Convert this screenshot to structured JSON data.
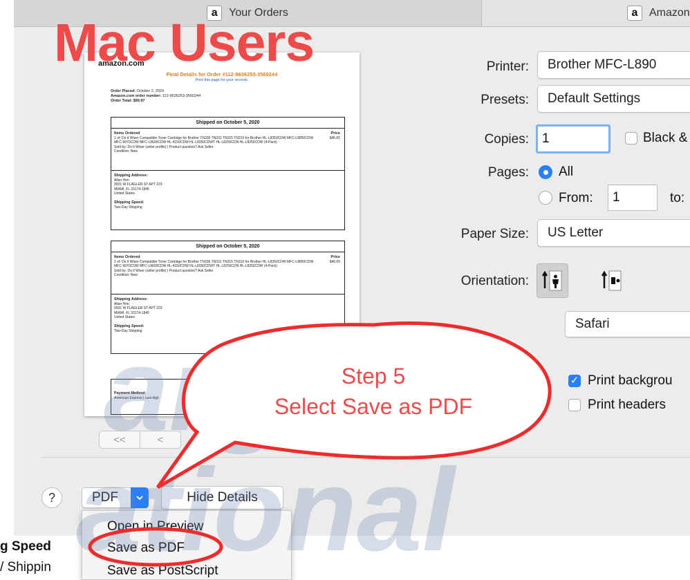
{
  "overlay": {
    "heading": "Mac Users",
    "callout_line1": "Step 5",
    "callout_line2": "Select Save as PDF",
    "accent_color": "#ef4a4a"
  },
  "tabs": [
    {
      "label": "Your Orders",
      "icon": "amazon-logo-icon"
    },
    {
      "label": "Amazon",
      "icon": "amazon-logo-icon"
    }
  ],
  "preview_doc": {
    "logo": "amazon.com",
    "title": "Final Details for Order #112-9636253-3560244",
    "print_link": "Print this page for your records.",
    "order_placed_label": "Order Placed:",
    "order_placed": "October 2, 2020",
    "order_number_label": "Amazon.com order number:",
    "order_number": "112-9636253-3560244",
    "order_total_label": "Order Total:",
    "order_total": "$90.97",
    "shipments": [
      {
        "heading": "Shipped on October 5, 2020",
        "items_label": "Items Ordered",
        "price_label": "Price",
        "item": "1 of: Do it Wiser Compatible Toner Cartridge for Brother TN336 TN331 TN315 TN310 for Brother HL-L8350CDW MFC-L8850CDW MFC-9970CDW MFC-L8600CDW HL-4150CDW HL-L8350CDWT HL-L8250CDN HL-L8250CDW (4-Pack)",
        "sold_by": "Sold by: Do it Wiser (seller profile) | Product question? Ask Seller",
        "condition": "Condition: New",
        "price": "$46.65",
        "ship_addr_label": "Shipping Address:",
        "ship_addr": [
          "Allan Hon",
          "9931 W FLAGLER ST APT 223",
          "MIAMI, FL 33174-1845",
          "United States"
        ],
        "speed_label": "Shipping Speed:",
        "speed": "Two-Day Shipping"
      },
      {
        "heading": "Shipped on October 5, 2020",
        "items_label": "Items Ordered",
        "price_label": "Price",
        "item": "1 of: Do it Wiser Compatible Toner Cartridge for Brother TN336 TN331 TN315 TN310 for Brother HL-L8350CDW MFC-L8850CDW MFC-9970CDW MFC-L8600CDW HL-4150CDW HL-L8350CDWT HL-L8250CDN HL-L8250CDW (4-Pack)",
        "sold_by": "Sold by: Do it Wiser (seller profile) | Product question? Ask Seller",
        "condition": "Condition: New",
        "price": "$46.65",
        "ship_addr_label": "Shipping Address:",
        "ship_addr": [
          "Allan Hon",
          "9931 W FLAGLER ST APT 223",
          "MIAMI, FL 33174-1845",
          "United States"
        ],
        "speed_label": "Shipping Speed:",
        "speed": "Two-Day Shipping"
      }
    ],
    "payment_label": "Payment Method:",
    "payment": "American Express | Last digit"
  },
  "pager": {
    "first": "<<",
    "prev": "<"
  },
  "print_settings": {
    "printer_label": "Printer:",
    "printer_value": "Brother MFC-L890",
    "presets_label": "Presets:",
    "presets_value": "Default Settings",
    "copies_label": "Copies:",
    "copies_value": "1",
    "bw_label": "Black &",
    "pages_label": "Pages:",
    "pages_all": "All",
    "pages_from": "From:",
    "pages_from_value": "1",
    "pages_to": "to:",
    "paper_label": "Paper Size:",
    "paper_value": "US Letter",
    "orientation_label": "Orientation:",
    "app_section": "Safari",
    "print_backgrounds": "Print backgrou",
    "print_headers": "Print headers"
  },
  "bottom_bar": {
    "help": "?",
    "pdf": "PDF",
    "hide_details": "Hide Details"
  },
  "pdf_menu": [
    "Open in Preview",
    "Save as PDF",
    "Save as PostScript"
  ],
  "background_page": {
    "line1": "g Speed",
    "line2": "/ Shippin"
  },
  "watermark": {
    "line1": "argo",
    "line2": "ational"
  }
}
